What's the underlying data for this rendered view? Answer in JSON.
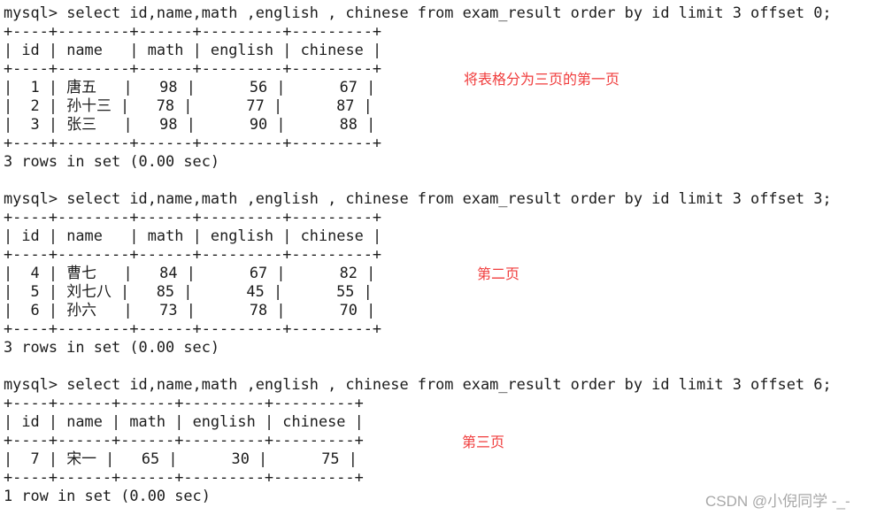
{
  "queries": [
    {
      "prompt": "mysql> ",
      "command": "select id,name,math ,english , chinese from exam_result order by id limit 3 offset 0;",
      "columns": [
        "id",
        "name",
        "math",
        "english",
        "chinese"
      ],
      "rows": [
        [
          "1",
          "唐五",
          "98",
          "56",
          "67"
        ],
        [
          "2",
          "孙十三",
          "78",
          "77",
          "87"
        ],
        [
          "3",
          "张三",
          "98",
          "90",
          "88"
        ]
      ],
      "summary": "3 rows in set (0.00 sec)",
      "annotation": "将表格分为三页的第一页"
    },
    {
      "prompt": "mysql> ",
      "command": "select id,name,math ,english , chinese from exam_result order by id limit 3 offset 3;",
      "columns": [
        "id",
        "name",
        "math",
        "english",
        "chinese"
      ],
      "rows": [
        [
          "4",
          "曹七",
          "84",
          "67",
          "82"
        ],
        [
          "5",
          "刘七八",
          "85",
          "45",
          "55"
        ],
        [
          "6",
          "孙六",
          "73",
          "78",
          "70"
        ]
      ],
      "summary": "3 rows in set (0.00 sec)",
      "annotation": "第二页"
    },
    {
      "prompt": "mysql> ",
      "command": "select id,name,math ,english , chinese from exam_result order by id limit 3 offset 6;",
      "columns": [
        "id",
        "name",
        "math",
        "english",
        "chinese"
      ],
      "rows": [
        [
          "7",
          "宋一",
          "65",
          "30",
          "75"
        ]
      ],
      "summary": "1 row in set (0.00 sec)",
      "annotation": "第三页"
    }
  ],
  "watermark": "CSDN @小倪同学 -_-",
  "colors": {
    "terminal_text": "#1c1c1c",
    "annotation": "#f03c3c",
    "watermark": "#a8a8a8",
    "background": "#ffffff"
  }
}
